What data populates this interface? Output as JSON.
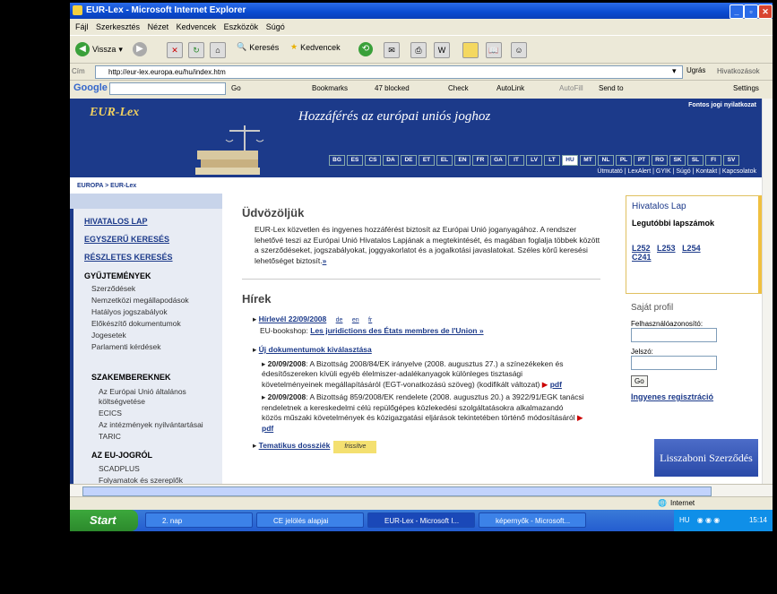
{
  "window": {
    "title": "EUR-Lex - Microsoft Internet Explorer"
  },
  "menu": [
    "Fájl",
    "Szerkesztés",
    "Nézet",
    "Kedvencek",
    "Eszközök",
    "Súgó"
  ],
  "toolbar": {
    "back": "Vissza",
    "search": "Keresés",
    "favorites": "Kedvencek"
  },
  "address": {
    "label": "Cím",
    "url": "http://eur-lex.europa.eu/hu/index.htm",
    "go": "Ugrás",
    "links": "Hivatkozások"
  },
  "google": {
    "brand": "Google",
    "go": "Go",
    "bookmarks": "Bookmarks",
    "blocked": "47 blocked",
    "check": "Check",
    "autolink": "AutoLink",
    "autofill": "AutoFill",
    "sendto": "Send to",
    "settings": "Settings"
  },
  "banner": {
    "logo": "EUR-Lex",
    "slogan": "Hozzáférés az európai uniós joghoz",
    "legal": "Fontos jogi nyilatkozat",
    "langs": [
      "BG",
      "ES",
      "CS",
      "DA",
      "DE",
      "ET",
      "EL",
      "EN",
      "FR",
      "GA",
      "IT",
      "LV",
      "LT",
      "HU",
      "MT",
      "NL",
      "PL",
      "PT",
      "RO",
      "SK",
      "SL",
      "FI",
      "SV"
    ],
    "active_lang": "HU",
    "topnav": "Útmutató | LexAlert | GYIK | Súgó | Kontakt | Kapcsolatok"
  },
  "breadcrumb": "EUROPA > EUR-Lex",
  "left": {
    "l1": "HIVATALOS LAP",
    "l2": "EGYSZERŰ KERESÉS",
    "l3": "RÉSZLETES KERESÉS",
    "coll": "GYŰJTEMÉNYEK",
    "items": [
      "Szerződések",
      "Nemzetközi megállapodások",
      "Hatályos jogszabályok",
      "Előkészítő dokumentumok",
      "Jogesetek",
      "Parlamenti kérdések"
    ],
    "prof": "SZAKEMBEREKNEK",
    "prof_items": [
      "Az Európai Unió általános",
      "költségvetése",
      "ECICS",
      "Az intézmények nyilvántartásai",
      "TARIC"
    ],
    "eu": "AZ EU-JOGRÓL",
    "eu_items": [
      "SCADPLUS",
      "Folyamatok és szereplők"
    ]
  },
  "main": {
    "welcome": "Üdvözöljük",
    "intro": "EUR-Lex közvetlen és ingyenes hozzáférést biztosít az Európai Unió joganyagához. A rendszer lehetővé teszi az Európai Unió Hivatalos Lapjának a megtekintését, és magában foglalja többek között a szerződéseket, jogszabályokat, joggyakorlatot és a jogalkotási javaslatokat. Széles körű keresési lehetőséget biztosít.",
    "intro_more": "»",
    "news": "Hírek",
    "nl_title": "Hírlevél 22/09/2008",
    "nl_de": "de",
    "nl_en": "en",
    "nl_fr": "fr",
    "bookshop_pre": "EU-bookshop:",
    "bookshop_link": "Les juridictions des États membres de l'Union »",
    "newdocs": "Új dokumentumok kiválasztása",
    "d1_date": "20/09/2008",
    "d1_text": ": A Bizottság 2008/84/EK irányelve (2008. augusztus 27.) a színezékeken és édesítőszereken kívüli egyéb élelmiszer-adalékanyagok különleges tisztasági követelményeinek megállapításáról (EGT-vonatkozású szöveg) (kodifikált változat)",
    "d2_date": "20/09/2008",
    "d2_text": ": A Bizottság 859/2008/EK rendelete (2008. augusztus 20.) a 3922/91/EGK tanácsi rendeletnek a kereskedelmi célú repülőgépes közlekedési szolgáltatásokra alkalmazandó közös műszaki követelmények és közigazgatási eljárások tekintetében történő módosításáról",
    "pdf": "pdf",
    "dossier": "Tematikus dossziék",
    "frissitve": "frissítve"
  },
  "right": {
    "hl": "Hivatalos Lap",
    "latest": "Legutóbbi lapszámok",
    "issues": [
      "L252",
      "L253",
      "L254",
      "C241"
    ],
    "profile": "Saját profil",
    "user": "Felhasználóazonosító:",
    "pass": "Jelszó:",
    "go": "Go",
    "reg": "Ingyenes regisztráció",
    "lisbon": "Lisszaboni Szerződés"
  },
  "status": {
    "zone": "Internet"
  },
  "taskbar": {
    "start": "Start",
    "tasks": [
      "2. nap",
      "CE jelölés alapjai",
      "EUR-Lex - Microsoft I...",
      "képernyők - Microsoft..."
    ],
    "lang": "HU",
    "clock": "15:14"
  }
}
